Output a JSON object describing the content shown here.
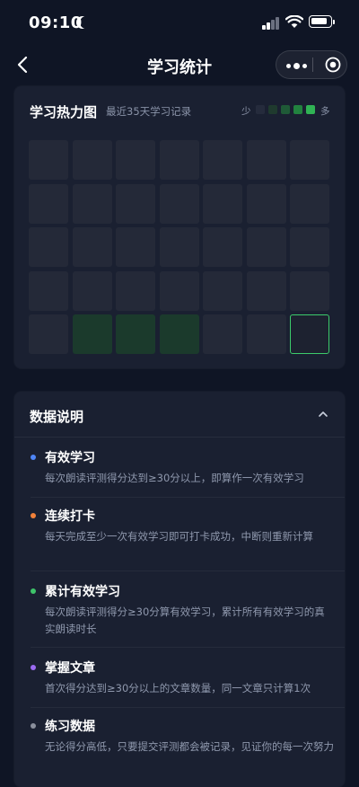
{
  "status_bar": {
    "time": "09:10"
  },
  "nav": {
    "title": "学习统计"
  },
  "heatmap": {
    "title": "学习热力图",
    "subtitle": "最近35天学习记录",
    "legend_low": "少",
    "legend_high": "多",
    "legend_colors": [
      "#252b3c",
      "#1f3a2e",
      "#1f5a37",
      "#22823f",
      "#30b354"
    ],
    "columns": 7,
    "rows": 5,
    "levels": [
      0,
      0,
      0,
      0,
      0,
      0,
      0,
      0,
      0,
      0,
      0,
      0,
      0,
      0,
      0,
      0,
      0,
      0,
      0,
      0,
      0,
      0,
      0,
      0,
      0,
      0,
      0,
      0,
      0,
      1,
      1,
      1,
      0,
      0,
      0
    ],
    "today_index": 34,
    "empty_color": "#242938",
    "active_color": "#1b3a2c",
    "today_border": "#3ccb6b"
  },
  "info": {
    "title": "数据说明",
    "items": [
      {
        "name": "有效学习",
        "desc": "每次朗读评测得分达到≥30分以上，即算作一次有效学习",
        "color": "#4f86f7"
      },
      {
        "name": "连续打卡",
        "desc": "每天完成至少一次有效学习即可打卡成功，中断则重新计算",
        "color": "#f2813a"
      },
      {
        "name": "累计有效学习",
        "desc": "每次朗读评测得分≥30分算有效学习，累计所有有效学习的真实朗读时长",
        "color": "#3ec36a"
      },
      {
        "name": "掌握文章",
        "desc": "首次得分达到≥30分以上的文章数量，同一文章只计算1次",
        "color": "#9b6bf2"
      },
      {
        "name": "练习数据",
        "desc": "无论得分高低，只要提交评测都会被记录，见证你的每一次努力",
        "color": "#8a8f9c"
      }
    ]
  }
}
